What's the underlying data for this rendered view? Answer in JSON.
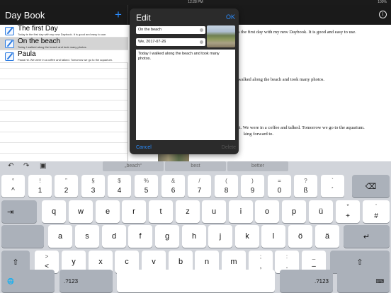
{
  "status": {
    "time": "12:28 PM",
    "battery": "100%"
  },
  "sidebar": {
    "title": "Day Book",
    "add_label": "+",
    "entries": [
      {
        "title": "The first Day",
        "snippet": "Today is the first day with my new Daybook. It is good and easy to use."
      },
      {
        "title": "On the beach",
        "snippet": "Today I walked along the beach and took many photos."
      },
      {
        "title": "Paula",
        "snippet": "Paula hit. We were in a coffee and talked. Tomorrow we go to the aquarium."
      }
    ]
  },
  "detail": {
    "info_label": "i",
    "lines": [
      "s the first day with my new Daybook. It is good and easy to use.",
      "walked along the beach and took many photos.",
      "it. We were in a coffee and talked. Tomorrow we go to the aquarium.",
      "king forward to."
    ]
  },
  "edit": {
    "title": "Edit",
    "ok_label": "OK",
    "title_field": "On the beach",
    "date_field": "We, 2017-07-26",
    "notes": "Today I walked along the beach and took many photos.",
    "cancel_label": "Cancel",
    "delete_label": "Delete"
  },
  "keyboard": {
    "undo_icon": "↶",
    "redo_icon": "↷",
    "paste_icon": "▣",
    "suggestions": [
      "„beach“",
      "best",
      "better"
    ],
    "row1": [
      {
        "u": "°",
        "l": "^"
      },
      {
        "u": "!",
        "l": "1"
      },
      {
        "u": "”",
        "l": "2"
      },
      {
        "u": "§",
        "l": "3"
      },
      {
        "u": "$",
        "l": "4"
      },
      {
        "u": "%",
        "l": "5"
      },
      {
        "u": "&",
        "l": "6"
      },
      {
        "u": "/",
        "l": "7"
      },
      {
        "u": "(",
        "l": "8"
      },
      {
        "u": ")",
        "l": "9"
      },
      {
        "u": "=",
        "l": "0"
      },
      {
        "u": "?",
        "l": "ß"
      },
      {
        "u": "`",
        "l": "´"
      }
    ],
    "delete_icon": "⌫",
    "tab_icon": "⇥",
    "row2": [
      "q",
      "w",
      "e",
      "r",
      "t",
      "z",
      "u",
      "i",
      "o",
      "p",
      "ü"
    ],
    "row2_last": {
      "u": "*",
      "l": "+"
    },
    "row2_extra": {
      "u": "'",
      "l": "#"
    },
    "row3": [
      "a",
      "s",
      "d",
      "f",
      "g",
      "h",
      "j",
      "k",
      "l",
      "ö",
      "ä"
    ],
    "return_icon": "↵",
    "shift_icon": "⇧",
    "row4_first": {
      "u": ">",
      "l": "<"
    },
    "row4": [
      "y",
      "x",
      "c",
      "v",
      "b",
      "n",
      "m"
    ],
    "row4_punct": [
      {
        "u": ";",
        "l": ","
      },
      {
        "u": ":",
        "l": "."
      },
      {
        "u": "_",
        "l": "–"
      }
    ],
    "globe_icon": "🌐",
    "num_label": ".?123",
    "dismiss_icon": "⌨"
  }
}
